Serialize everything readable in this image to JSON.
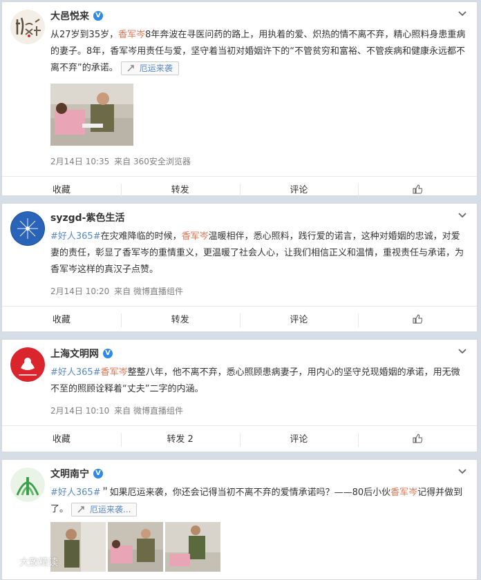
{
  "colors": {
    "highlight_red": "#eb7350",
    "link_blue": "#5a89c2",
    "meta_gray": "#808080",
    "verified_blue": "#2e8ae6"
  },
  "posts": [
    {
      "user": "大邑悦来",
      "verified": true,
      "segments": [
        {
          "t": "从27岁到35岁，",
          "c": ""
        },
        {
          "t": "香军岑",
          "c": "red"
        },
        {
          "t": "8年奔波在寻医问药的路上，用执着的爱、炽热的情不离不弃，精心照料身患重病的妻子。8年，香军岑用责任与爱，坚守着当初对婚姻许下的“不管贫穷和富裕、不管疾病和健康永远都不离不弃”的承诺。",
          "c": ""
        }
      ],
      "topic": "厄运来袭",
      "meta_time": "2月14日 10:35",
      "meta_from": "来自 360安全浏览器",
      "actions": [
        "收藏",
        "转发",
        "评论",
        ""
      ]
    },
    {
      "user": "syzgd-紫色生活",
      "verified": false,
      "segments": [
        {
          "t": "#好人365#",
          "c": "blue"
        },
        {
          "t": "在灾难降临的时候，",
          "c": ""
        },
        {
          "t": "香军岑",
          "c": "red"
        },
        {
          "t": "温暖相伴，悉心照料，践行爱的诺言，这种对婚姻的忠诚，对爱妻的责任，彰显了香军岑的重情重义，更温暖了社会人心，让我们相信正义和温情，重视责任与承诺，为香军岑这样的真汉子点赞。",
          "c": ""
        }
      ],
      "meta_time": "2月14日 10:20",
      "meta_from": "来自 微博直播组件",
      "actions": [
        "收藏",
        "转发",
        "评论",
        ""
      ]
    },
    {
      "user": "上海文明网",
      "verified": true,
      "segments": [
        {
          "t": "#好人365#",
          "c": "blue"
        },
        {
          "t": "香军岑",
          "c": "red"
        },
        {
          "t": "整整八年，他不离不弃，悉心照顾患病妻子，用内心的坚守兑现婚姻的承诺，用无微不至的照顾诠释着“丈夫”二字的内涵。",
          "c": ""
        }
      ],
      "meta_time": "2月14日 10:10",
      "meta_from": "来自 微博直播组件",
      "actions": [
        "收藏",
        "转发 2",
        "评论",
        ""
      ]
    },
    {
      "user": "文明南宁",
      "verified": true,
      "segments": [
        {
          "t": "#好人365#",
          "c": "blue"
        },
        {
          "t": "＂如果厄运来袭，你还会记得当初不离不弃的爱情承诺吗？——80后小伙",
          "c": ""
        },
        {
          "t": "香军岑",
          "c": "red"
        },
        {
          "t": "记得并做到了。",
          "c": ""
        }
      ],
      "topic": "厄运来袭...",
      "watermark": "大致精读"
    }
  ],
  "icons": {
    "dropdown": "chevron-down-icon",
    "like": "thumbs-up-icon",
    "topic": "link-icon",
    "verified": "verified-v-icon"
  }
}
